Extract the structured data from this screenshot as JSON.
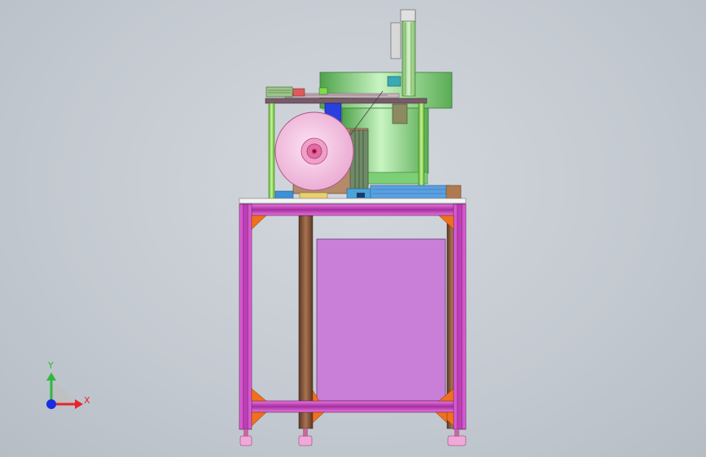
{
  "viewport": {
    "background_color": "#c8ced5"
  },
  "triad": {
    "x_label": "X",
    "y_label": "Y",
    "x_color": "#e8232a",
    "y_color": "#2db83d",
    "z_color": "#1a2de0"
  },
  "model": {
    "frame_color": "#d04bc8",
    "frame_dark": "#8a2a86",
    "corner_bracket_color": "#f07020",
    "panel_color": "#c97fd8",
    "post_color": "#8c5a3a",
    "table_top_color": "#f2f2f2",
    "bowl_color": "#8ee08a",
    "support_rod_color": "#8fe05a",
    "spool_color": "#f5bde0",
    "spool_hub_color": "#e36aa0",
    "base_rail_color": "#3d8fd8",
    "foot_color": "#f0a8d8"
  }
}
